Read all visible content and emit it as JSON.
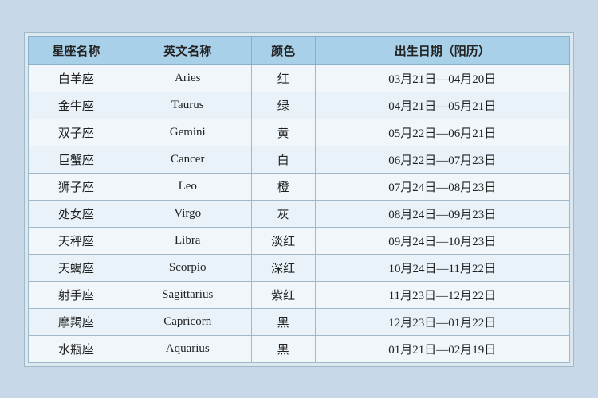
{
  "table": {
    "headers": [
      {
        "id": "col-chinese-name",
        "label": "星座名称"
      },
      {
        "id": "col-english-name",
        "label": "英文名称"
      },
      {
        "id": "col-color",
        "label": "颜色"
      },
      {
        "id": "col-date",
        "label": "出生日期（阳历）"
      }
    ],
    "rows": [
      {
        "chinese": "白羊座",
        "english": "Aries",
        "color": "红",
        "date": "03月21日—04月20日"
      },
      {
        "chinese": "金牛座",
        "english": "Taurus",
        "color": "绿",
        "date": "04月21日—05月21日"
      },
      {
        "chinese": "双子座",
        "english": "Gemini",
        "color": "黄",
        "date": "05月22日—06月21日"
      },
      {
        "chinese": "巨蟹座",
        "english": "Cancer",
        "color": "白",
        "date": "06月22日—07月23日"
      },
      {
        "chinese": "狮子座",
        "english": "Leo",
        "color": "橙",
        "date": "07月24日—08月23日"
      },
      {
        "chinese": "处女座",
        "english": "Virgo",
        "color": "灰",
        "date": "08月24日—09月23日"
      },
      {
        "chinese": "天秤座",
        "english": "Libra",
        "color": "淡红",
        "date": "09月24日—10月23日"
      },
      {
        "chinese": "天蝎座",
        "english": "Scorpio",
        "color": "深红",
        "date": "10月24日—11月22日"
      },
      {
        "chinese": "射手座",
        "english": "Sagittarius",
        "color": "紫红",
        "date": "11月23日—12月22日"
      },
      {
        "chinese": "摩羯座",
        "english": "Capricorn",
        "color": "黑",
        "date": "12月23日—01月22日"
      },
      {
        "chinese": "水瓶座",
        "english": "Aquarius",
        "color": "黑",
        "date": "01月21日—02月19日"
      }
    ]
  }
}
